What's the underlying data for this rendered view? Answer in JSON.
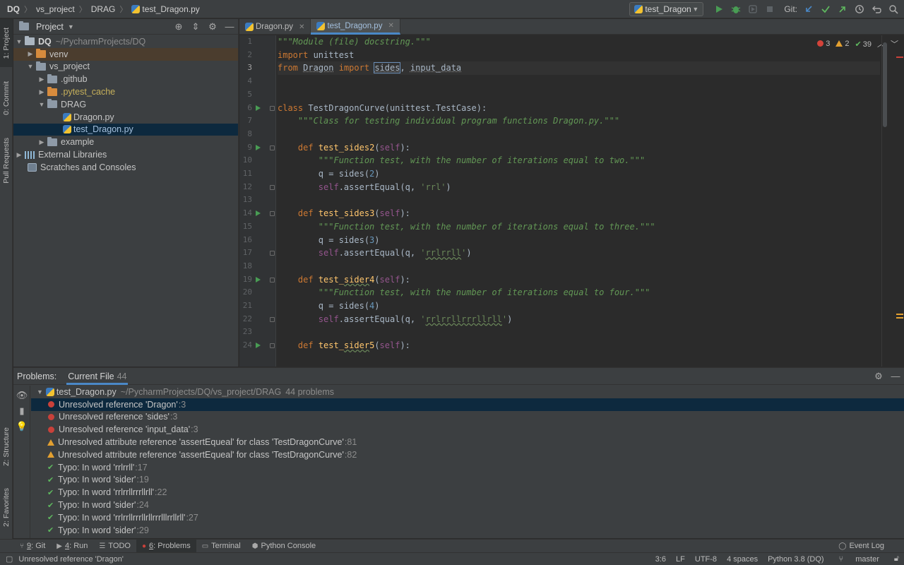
{
  "navbar": {
    "crumbs": [
      "DQ",
      "vs_project",
      "DRAG",
      "test_Dragon.py"
    ],
    "run_config": "test_Dragon",
    "git_label": "Git:"
  },
  "left_stripe": {
    "project": "1: Project",
    "commit": "0: Commit",
    "pull_requests": "Pull Requests",
    "structure": "Z: Structure",
    "favorites": "2: Favorites"
  },
  "project": {
    "title": "Project",
    "tree": [
      {
        "label": "DQ",
        "path": "~/PycharmProjects/DQ"
      },
      {
        "label": "venv"
      },
      {
        "label": "vs_project"
      },
      {
        "label": ".github"
      },
      {
        "label": ".pytest_cache"
      },
      {
        "label": "DRAG"
      },
      {
        "label": "Dragon.py"
      },
      {
        "label": "test_Dragon.py"
      },
      {
        "label": "example"
      },
      {
        "label": "External Libraries"
      },
      {
        "label": "Scratches and Consoles"
      }
    ]
  },
  "editor": {
    "tabs": [
      {
        "label": "Dragon.py",
        "active": false
      },
      {
        "label": "test_Dragon.py",
        "active": true
      }
    ],
    "inspections": {
      "errors": "3",
      "warnings": "2",
      "typos": "39"
    },
    "current_line": "3",
    "lines": [
      "1",
      "2",
      "3",
      "4",
      "5",
      "6",
      "7",
      "8",
      "9",
      "10",
      "11",
      "12",
      "13",
      "14",
      "15",
      "16",
      "17",
      "18",
      "19",
      "20",
      "21",
      "22",
      "23",
      "24"
    ]
  },
  "problems": {
    "label": "Problems:",
    "tab": "Current File",
    "count": "44",
    "file": {
      "name": "test_Dragon.py",
      "path": "~/PycharmProjects/DQ/vs_project/DRAG",
      "summary": "44 problems"
    },
    "items": [
      {
        "kind": "error",
        "text": "Unresolved reference 'Dragon'",
        "loc": ":3"
      },
      {
        "kind": "error",
        "text": "Unresolved reference 'sides'",
        "loc": ":3"
      },
      {
        "kind": "error",
        "text": "Unresolved reference 'input_data'",
        "loc": ":3"
      },
      {
        "kind": "warning",
        "text": "Unresolved attribute reference 'assertEqueal' for class 'TestDragonCurve'",
        "loc": ":81"
      },
      {
        "kind": "warning",
        "text": "Unresolved attribute reference 'assertEqueal' for class 'TestDragonCurve'",
        "loc": ":82"
      },
      {
        "kind": "typo",
        "text": "Typo: In word 'rrlrrll'",
        "loc": ":17"
      },
      {
        "kind": "typo",
        "text": "Typo: In word 'sider'",
        "loc": ":19"
      },
      {
        "kind": "typo",
        "text": "Typo: In word 'rrlrrllrrrllrll'",
        "loc": ":22"
      },
      {
        "kind": "typo",
        "text": "Typo: In word 'sider'",
        "loc": ":24"
      },
      {
        "kind": "typo",
        "text": "Typo: In word 'rrlrrllrrrllrllrrrlllrrllrll'",
        "loc": ":27"
      },
      {
        "kind": "typo",
        "text": "Typo: In word 'sider'",
        "loc": ":29"
      }
    ]
  },
  "bottom_tabs": [
    {
      "num": "9",
      "label": ": Git"
    },
    {
      "num": "4",
      "label": ": Run"
    },
    {
      "num": "",
      "label": "TODO"
    },
    {
      "num": "6",
      "label": ": Problems"
    },
    {
      "num": "",
      "label": "Terminal"
    },
    {
      "num": "",
      "label": "Python Console"
    }
  ],
  "event_log": "Event Log",
  "status": {
    "message": "Unresolved reference 'Dragon'",
    "position": "3:6",
    "line_sep": "LF",
    "encoding": "UTF-8",
    "indent": "4 spaces",
    "interpreter": "Python 3.8 (DQ)",
    "branch": "master"
  },
  "colors": {
    "background": "#2b2b2b",
    "panel": "#3c3f41",
    "selection": "#0d293e",
    "accent": "#4a88c7",
    "keyword": "#cc7832",
    "docstring": "#629755",
    "function": "#ffc66d",
    "error": "#c9413a",
    "warning": "#e3a030",
    "typo": "#5fb85f"
  }
}
